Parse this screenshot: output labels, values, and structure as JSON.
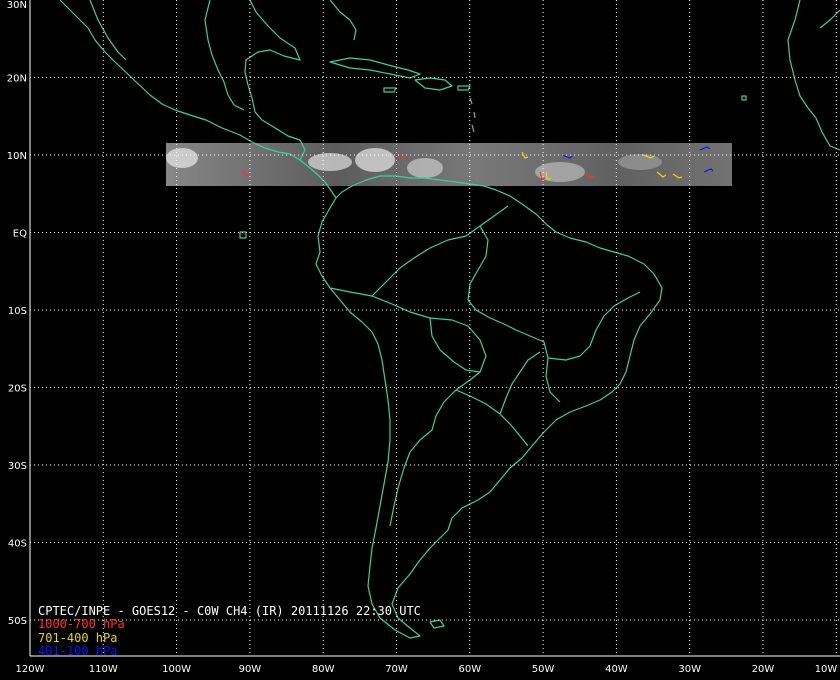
{
  "map": {
    "caption": "CPTEC/INPE - GOES12 - C0W CH4 (IR) 20111126 22:30 UTC",
    "legend": [
      {
        "label": "1000-700 hPa",
        "color": "#ff3030"
      },
      {
        "label": "701-400 hPa",
        "color": "#e8d800"
      },
      {
        "label": "401-100 hPa",
        "color": "#1010ff"
      }
    ],
    "lat_labels": [
      "30N",
      "20N",
      "10N",
      "EQ",
      "10S",
      "20S",
      "30S",
      "40S",
      "50S"
    ],
    "lon_labels": [
      "120W",
      "110W",
      "100W",
      "90W",
      "80W",
      "70W",
      "60W",
      "50W",
      "40W",
      "30W",
      "20W",
      "10W"
    ],
    "coastline_color": "#3ad29a",
    "grid_color": "#ffffff",
    "background": "#000000"
  }
}
